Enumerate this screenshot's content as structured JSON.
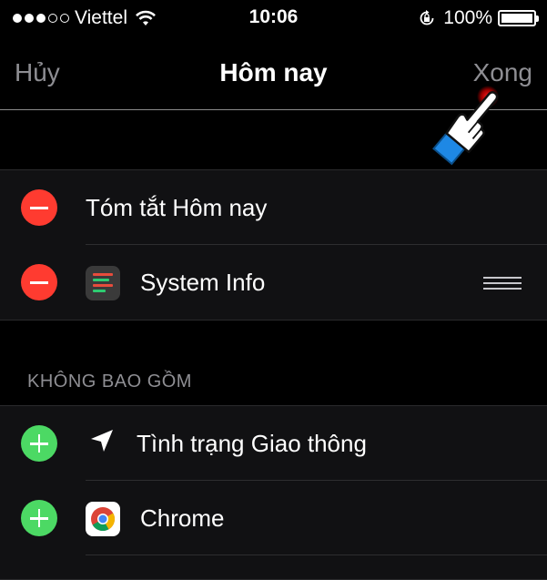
{
  "status_bar": {
    "carrier": "Viettel",
    "time": "10:06",
    "battery": "100%"
  },
  "nav": {
    "cancel_label": "Hủy",
    "title": "Hôm nay",
    "done_label": "Xong"
  },
  "included": [
    {
      "label": "Tóm tắt Hôm nay"
    },
    {
      "label": "System Info"
    }
  ],
  "excluded_header": "KHÔNG BAO GỒM",
  "excluded": [
    {
      "label": "Tình trạng Giao thông"
    },
    {
      "label": "Chrome"
    }
  ],
  "colors": {
    "remove": "#ff3b30",
    "add": "#4cd964",
    "background": "#000000",
    "cell": "#111113"
  }
}
